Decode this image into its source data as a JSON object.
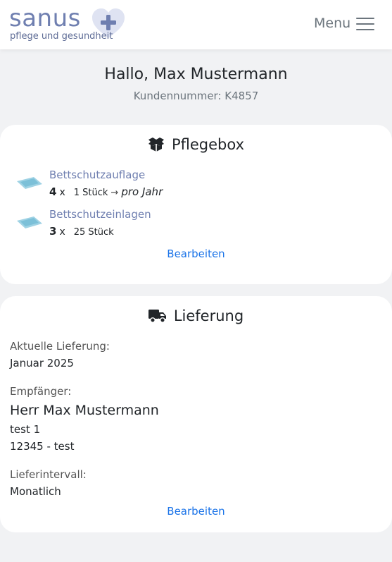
{
  "header": {
    "logo_word": "sanus",
    "logo_tagline": "pflege und gesundheit",
    "menu_label": "Menu"
  },
  "greeting": "Hallo, Max Mustermann",
  "customer_number": "Kundennummer: K4857",
  "pflegebox": {
    "title": "Pflegebox",
    "items": [
      {
        "name": "Bettschutzauflage",
        "quantity": "4",
        "multiplier": "x",
        "pack": "1 Stück",
        "arrow": "→",
        "frequency": "pro Jahr"
      },
      {
        "name": "Bettschutzeinlagen",
        "quantity": "3",
        "multiplier": "x",
        "pack": "25 Stück"
      }
    ],
    "edit_label": "Bearbeiten"
  },
  "lieferung": {
    "title": "Lieferung",
    "current_label": "Aktuelle Lieferung:",
    "current_value": "Januar 2025",
    "recipient_label": "Empfänger:",
    "recipient_name": "Herr Max Mustermann",
    "address_line1": "test 1",
    "address_line2": "12345 - test",
    "interval_label": "Lieferintervall:",
    "interval_value": "Monatlich",
    "edit_label": "Bearbeiten"
  },
  "colors": {
    "brand": "#6f7fb0",
    "link": "#1a73e8",
    "background": "#f1f2f4"
  },
  "icons": {
    "box": "box-open-icon",
    "delivery": "truck-icon",
    "menu": "hamburger-icon",
    "logo": "heart-plus-icon"
  }
}
